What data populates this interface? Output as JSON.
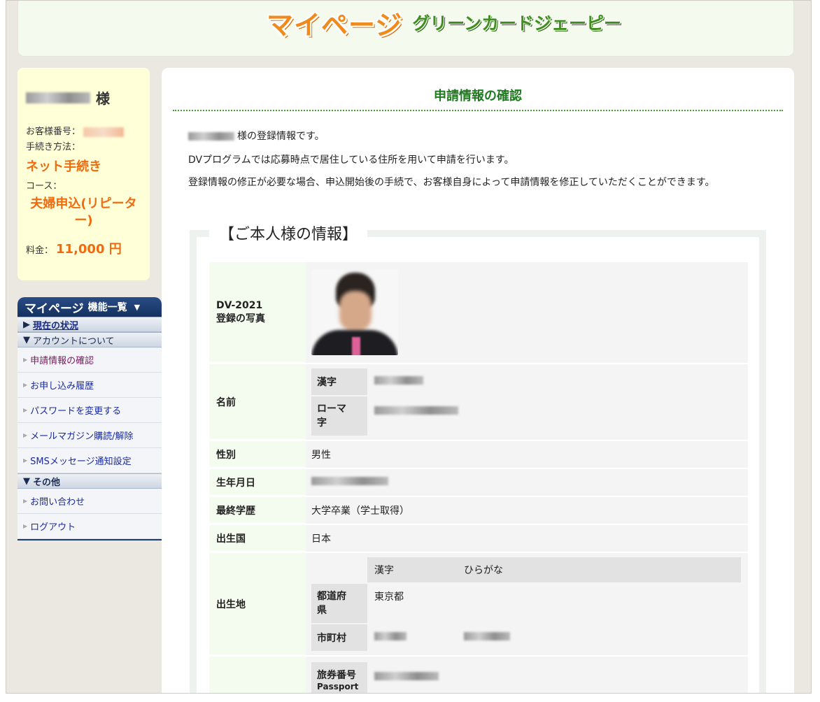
{
  "header": {
    "logo_main": "マイページ",
    "logo_sub": "グリーンカードジェーピー"
  },
  "user": {
    "name_suffix": "様",
    "customer_no_label": "お客様番号：",
    "method_label": "手続き方法：",
    "method_value": "ネット手続き",
    "course_label": "コース：",
    "course_value": "夫婦申込(リピーター)",
    "fee_label": "料金：",
    "fee_value": "11,000 円"
  },
  "menu": {
    "title_main": "マイページ",
    "title_sub": "機能一覧",
    "title_arrow": "▼",
    "current_status": "現在の状況",
    "account_section": "アカウントについて",
    "items": [
      {
        "label": "申請情報の確認"
      },
      {
        "label": "お申し込み履歴"
      },
      {
        "label": "パスワードを変更する"
      },
      {
        "label": "メールマガジン購読/解除"
      },
      {
        "label": "SMSメッセージ通知設定"
      }
    ],
    "other_section": "その他",
    "other_items": [
      {
        "label": "お問い合わせ"
      },
      {
        "label": "ログアウト"
      }
    ]
  },
  "main": {
    "title": "申請情報の確認",
    "intro_suffix": "様の登録情報です。",
    "intro_line2": "DVプログラムでは応募時点で居住している住所を用いて申請を行います。",
    "intro_line3": "登録情報の修正が必要な場合、申込開始後の手続で、お客様自身によって申請情報を修正していただくことができます。",
    "section_title": "【ご本人様の情報】",
    "rows": {
      "photo_label_1": "DV-2021",
      "photo_label_2": "登録の写真",
      "name_label": "名前",
      "kanji_label": "漢字",
      "roman_label": "ローマ字",
      "gender_label": "性別",
      "gender_value": "男性",
      "birth_label": "生年月日",
      "education_label": "最終学歴",
      "education_value": "大学卒業（学士取得）",
      "country_label": "出生国",
      "country_value": "日本",
      "birthplace_label": "出生地",
      "bp_kanji": "漢字",
      "bp_hiragana": "ひらがな",
      "prefecture_label": "都道府県",
      "prefecture_value": "東京都",
      "city_label": "市町村",
      "passport_label": "旅券番号",
      "passport_sub": "Passport"
    }
  }
}
